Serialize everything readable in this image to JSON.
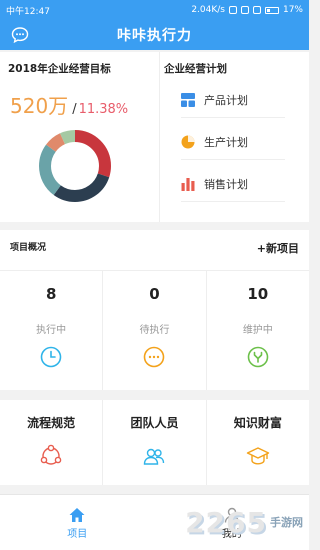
{
  "status_bar": {
    "time": "中午12:47",
    "speed": "2.04K/s",
    "battery": "17%"
  },
  "header": {
    "title": "咔咔执行力",
    "chat_icon": "chat-bubble-icon"
  },
  "goal": {
    "title": "2018年企业经营目标",
    "amount": "520万",
    "separator": "/",
    "rate": "11.38%",
    "donut": [
      {
        "value": 30,
        "color": "#c8363d"
      },
      {
        "value": 30,
        "color": "#2c3e50"
      },
      {
        "value": 25,
        "color": "#6aa3a8"
      },
      {
        "value": 8,
        "color": "#e08a6b"
      },
      {
        "value": 7,
        "color": "#a5c9a3"
      }
    ]
  },
  "plan": {
    "title": "企业经营计划",
    "items": [
      {
        "label": "产品计划",
        "icon": "grid-icon",
        "color": "#3a8ee6"
      },
      {
        "label": "生产计划",
        "icon": "pie-icon",
        "color": "#f3a21b"
      },
      {
        "label": "销售计划",
        "icon": "bar-chart-icon",
        "color": "#e85d4f"
      }
    ]
  },
  "project": {
    "title": "项目概况",
    "add_label": "+新项目",
    "stats": [
      {
        "value": "8",
        "label": "执行中",
        "icon": "clock-icon",
        "color": "#2fb4e9"
      },
      {
        "value": "0",
        "label": "待执行",
        "icon": "more-icon",
        "color": "#f3a21b"
      },
      {
        "value": "10",
        "label": "维护中",
        "icon": "wrench-icon",
        "color": "#6cc04a"
      }
    ]
  },
  "links": [
    {
      "label": "流程规范",
      "icon": "process-icon",
      "color": "#e85d4f"
    },
    {
      "label": "团队人员",
      "icon": "team-icon",
      "color": "#2fb4e9"
    },
    {
      "label": "知识财富",
      "icon": "graduation-cap-icon",
      "color": "#f3a21b"
    }
  ],
  "tabs": [
    {
      "label": "项目",
      "icon": "home-icon",
      "active": true
    },
    {
      "label": "我的",
      "icon": "user-icon",
      "active": false
    }
  ],
  "watermark": {
    "main": "2265",
    "suffix": "手游网"
  }
}
